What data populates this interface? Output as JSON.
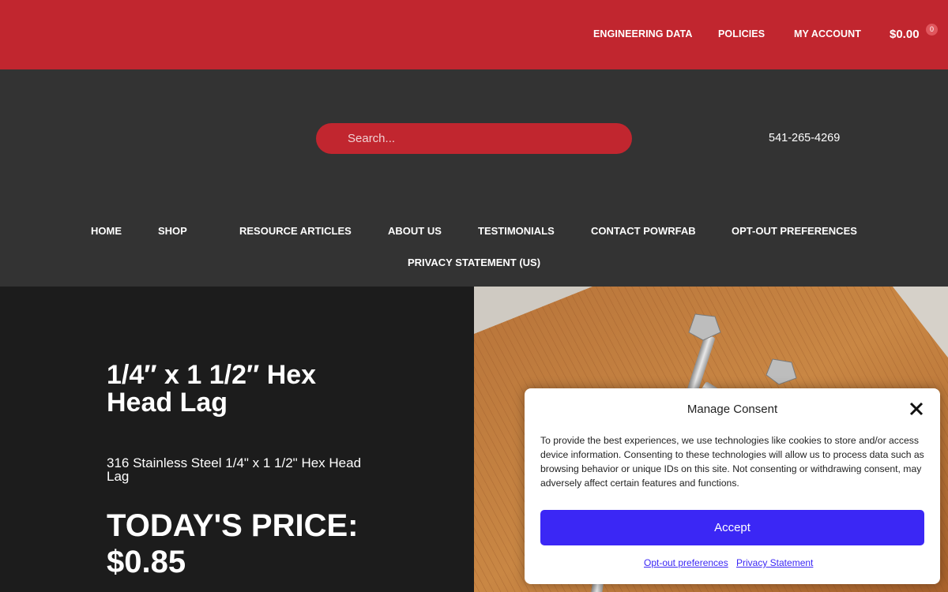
{
  "topbar": {
    "nav": [
      "ENGINEERING DATA",
      "POLICIES",
      "MY ACCOUNT"
    ],
    "cart_total": "$0.00",
    "cart_count": "0"
  },
  "header": {
    "search_placeholder": "Search...",
    "phone": "541-265-4269"
  },
  "main_nav": {
    "row1": [
      "HOME",
      "SHOP",
      "RESOURCE ARTICLES",
      "ABOUT US",
      "TESTIMONIALS",
      "CONTACT POWRFAB",
      "OPT-OUT PREFERENCES"
    ],
    "row2": [
      "PRIVACY STATEMENT (US)"
    ]
  },
  "product": {
    "title": "1/4″ x 1 1/2″ Hex Head Lag",
    "description": "316 Stainless Steel 1/4\" x 1 1/2\" Hex Head Lag",
    "price_label": "TODAY'S PRICE:",
    "price": "$0.85"
  },
  "consent": {
    "title": "Manage Consent",
    "text": "To provide the best experiences, we use technologies like cookies to store and/or access device information. Consenting to these technologies will allow us to process data such as browsing behavior or unique IDs on this site. Not consenting or withdrawing consent, may adversely affect certain features and functions.",
    "accept": "Accept",
    "opt_out_link": "Opt-out preferences",
    "privacy_link": "Privacy Statement"
  },
  "colors": {
    "brand_red": "#c1262f",
    "header_gray": "#333333",
    "accept_blue": "#3b27f5"
  }
}
